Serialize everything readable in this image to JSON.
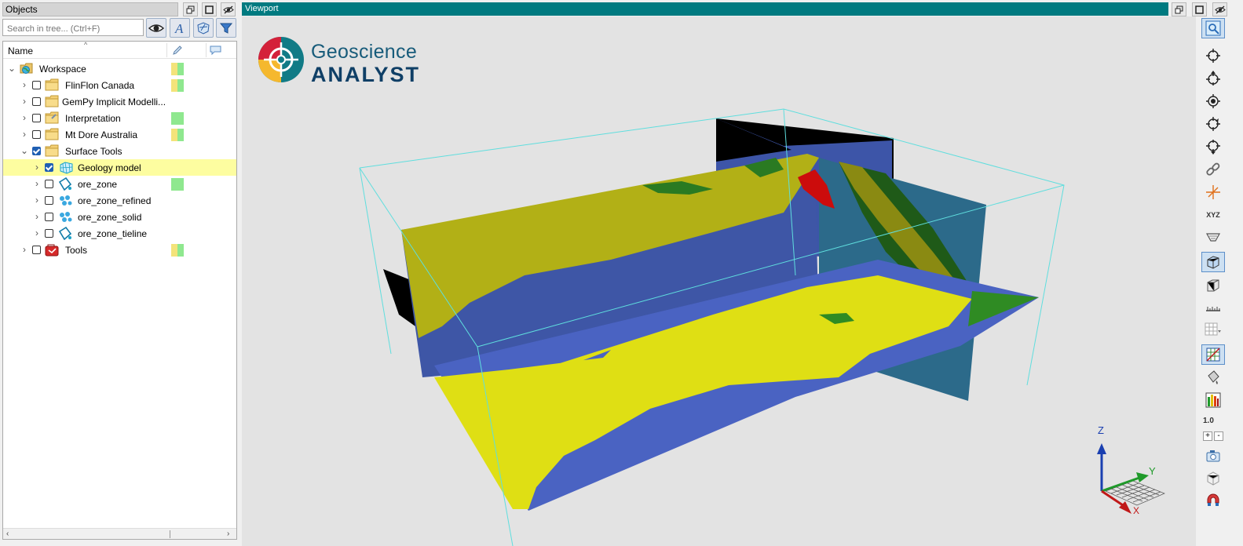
{
  "objects_panel": {
    "title": "Objects",
    "search_placeholder": "Search in tree... (Ctrl+F)",
    "column_name": "Name"
  },
  "tree": [
    {
      "label": "Workspace",
      "icon": "workspace-globe-icon",
      "checkbox": false,
      "expanded": true,
      "swatch": [
        "#f3e37a",
        "#8fe88f"
      ]
    },
    {
      "label": "FlinFlon Canada",
      "icon": "folder-icon",
      "checkbox": true,
      "checked": false,
      "swatch": [
        "#f3e37a",
        "#8fe88f"
      ]
    },
    {
      "label": "GemPy Implicit Modelli...",
      "icon": "folder-icon",
      "checkbox": true,
      "checked": false,
      "swatch": null
    },
    {
      "label": "Interpretation",
      "icon": "folder-icon",
      "checkbox": true,
      "checked": false,
      "swatch": [
        "#8fe88f",
        "#8fe88f"
      ]
    },
    {
      "label": "Mt Dore Australia",
      "icon": "folder-icon",
      "checkbox": true,
      "checked": false,
      "swatch": [
        "#f3e37a",
        "#8fe88f"
      ]
    },
    {
      "label": "Surface Tools",
      "icon": "folder-icon",
      "checkbox": true,
      "checked": true,
      "swatch": null
    },
    {
      "label": "Geology model",
      "icon": "block-model-icon",
      "checkbox": true,
      "checked": true,
      "swatch": null,
      "selected": true
    },
    {
      "label": "ore_zone",
      "icon": "surface-icon",
      "checkbox": true,
      "checked": false,
      "swatch": [
        "#8fe88f",
        "#8fe88f"
      ]
    },
    {
      "label": "ore_zone_refined",
      "icon": "points-icon",
      "checkbox": true,
      "checked": false,
      "swatch": null
    },
    {
      "label": "ore_zone_solid",
      "icon": "points-icon",
      "checkbox": true,
      "checked": false,
      "swatch": null
    },
    {
      "label": "ore_zone_tieline",
      "icon": "surface-icon",
      "checkbox": true,
      "checked": false,
      "swatch": null
    },
    {
      "label": "Tools",
      "icon": "tools-icon",
      "checkbox": true,
      "checked": false,
      "swatch": [
        "#f3e37a",
        "#8fe88f"
      ]
    }
  ],
  "viewport": {
    "title": "Viewport",
    "logo_line1": "Geoscience",
    "logo_line2": "ANALYST",
    "axis_z": "Z",
    "axis_y": "Y",
    "axis_x": "X",
    "toolbar_xyz": "XYZ",
    "toolbar_scale": "1.0",
    "zoom_in": "+",
    "zoom_out": "-"
  },
  "colors": {
    "viewport_title": "#007a80",
    "selection": "#fdfda0",
    "geology_yellow": "#dfdf14",
    "geology_blue": "#4a63c2",
    "geology_green": "#2f8b23",
    "geology_red": "#d40a0a",
    "bounding_box": "#5fdede"
  }
}
